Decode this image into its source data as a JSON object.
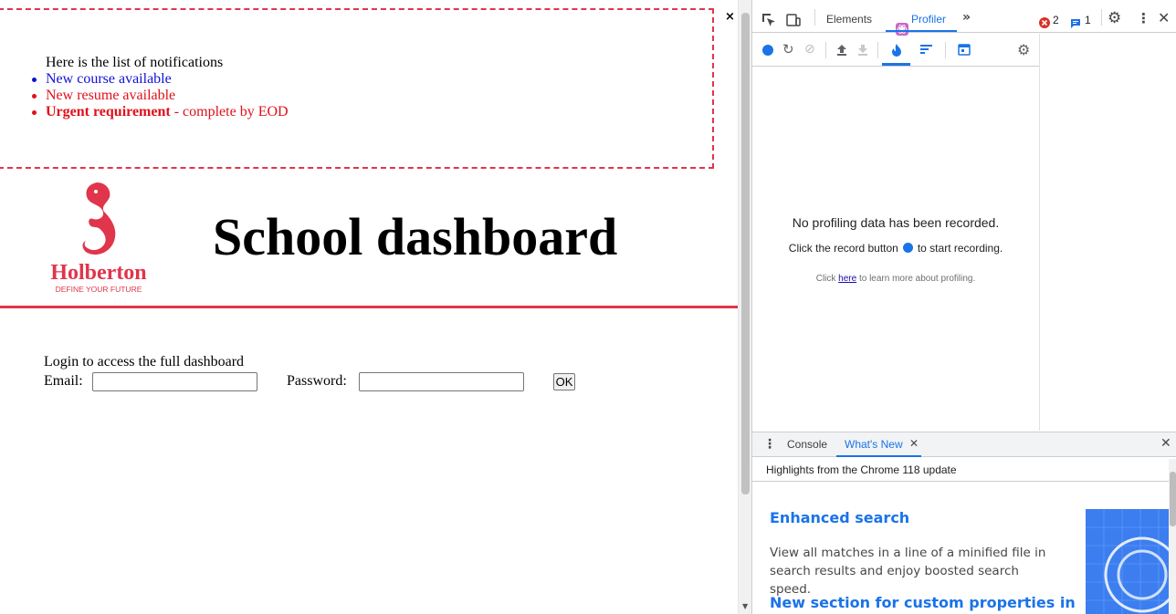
{
  "notifications": {
    "close_label": "×",
    "title": "Here is the list of notifications",
    "items": [
      {
        "text": "New course available",
        "color": "#1010d8"
      },
      {
        "text": "New resume available",
        "color": "#e0101a"
      },
      {
        "strong": "Urgent requirement",
        "rest": " - complete by EOD",
        "color": "#e0101a"
      }
    ]
  },
  "header": {
    "logo_wordmark": "Holberton",
    "logo_tagline": "DEFINE YOUR FUTURE",
    "title": "School dashboard",
    "accent_color": "#e0354b"
  },
  "login": {
    "intro": "Login to access the full dashboard",
    "email_label": "Email:",
    "email_value": "",
    "password_label": "Password:",
    "password_value": "",
    "submit_label": "OK"
  },
  "devtools": {
    "tabs": [
      {
        "label": "Elements",
        "icon": ""
      },
      {
        "label": "Profiler",
        "icon": "react-icon",
        "active": true
      }
    ],
    "more_tabs_icon": "chevron-double-right-icon",
    "error_count": "2",
    "message_count": "1",
    "profiler": {
      "no_data_title": "No profiling data has been recorded.",
      "hint_before": "Click the record button",
      "hint_after": "to start recording.",
      "learn_before": "Click ",
      "learn_link": "here",
      "learn_after": " to learn more about profiling."
    },
    "drawer": {
      "tabs": [
        {
          "label": "Console"
        },
        {
          "label": "What's New",
          "active": true
        }
      ],
      "header": "Highlights from the Chrome 118 update",
      "items": [
        {
          "title": "Enhanced search",
          "description": "View all matches in a line of a minified file in search results and enjoy boosted search speed."
        },
        {
          "title": "New section for custom properties in"
        }
      ]
    },
    "accent_color": "#1a73e8"
  }
}
